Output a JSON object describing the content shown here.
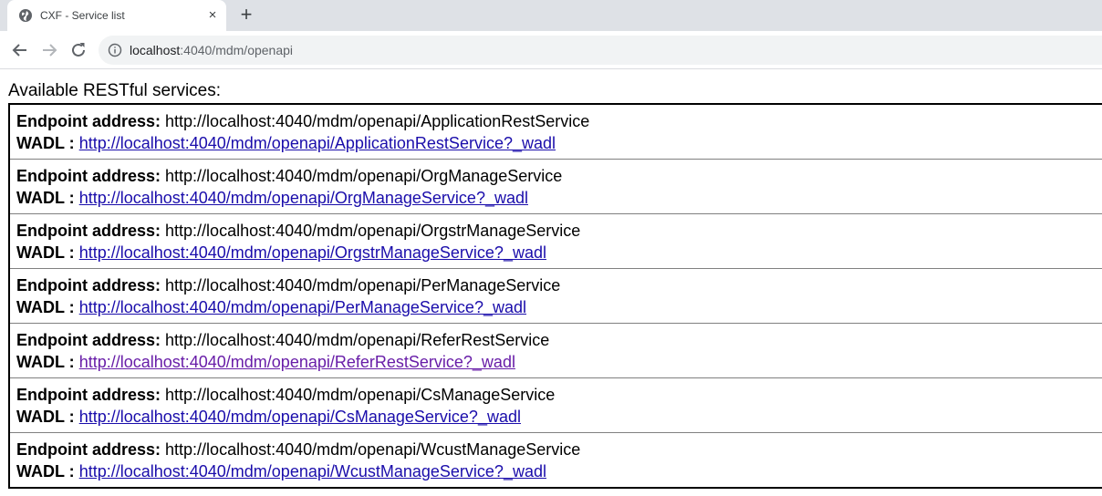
{
  "browser": {
    "tab_title": "CXF - Service list",
    "tab_close": "×",
    "new_tab": "+",
    "url_host": "localhost",
    "url_rest": ":4040/mdm/openapi"
  },
  "page": {
    "heading": "Available RESTful services:",
    "endpoint_label": "Endpoint address:",
    "wadl_label": "WADL :",
    "services": [
      {
        "endpoint": "http://localhost:4040/mdm/openapi/ApplicationRestService",
        "wadl": "http://localhost:4040/mdm/openapi/ApplicationRestService?_wadl",
        "visited": false
      },
      {
        "endpoint": "http://localhost:4040/mdm/openapi/OrgManageService",
        "wadl": "http://localhost:4040/mdm/openapi/OrgManageService?_wadl",
        "visited": false
      },
      {
        "endpoint": "http://localhost:4040/mdm/openapi/OrgstrManageService",
        "wadl": "http://localhost:4040/mdm/openapi/OrgstrManageService?_wadl",
        "visited": false
      },
      {
        "endpoint": "http://localhost:4040/mdm/openapi/PerManageService",
        "wadl": "http://localhost:4040/mdm/openapi/PerManageService?_wadl",
        "visited": false
      },
      {
        "endpoint": "http://localhost:4040/mdm/openapi/ReferRestService",
        "wadl": "http://localhost:4040/mdm/openapi/ReferRestService?_wadl",
        "visited": true
      },
      {
        "endpoint": "http://localhost:4040/mdm/openapi/CsManageService",
        "wadl": "http://localhost:4040/mdm/openapi/CsManageService?_wadl",
        "visited": false
      },
      {
        "endpoint": "http://localhost:4040/mdm/openapi/WcustManageService",
        "wadl": "http://localhost:4040/mdm/openapi/WcustManageService?_wadl",
        "visited": false
      }
    ]
  },
  "icons": {
    "favicon": "globe-icon",
    "back": "arrow-left-icon",
    "forward": "arrow-right-icon",
    "reload": "reload-icon",
    "site_info": "info-icon"
  },
  "colors": {
    "link": "#1a0dab",
    "visited_link": "#681da8"
  }
}
